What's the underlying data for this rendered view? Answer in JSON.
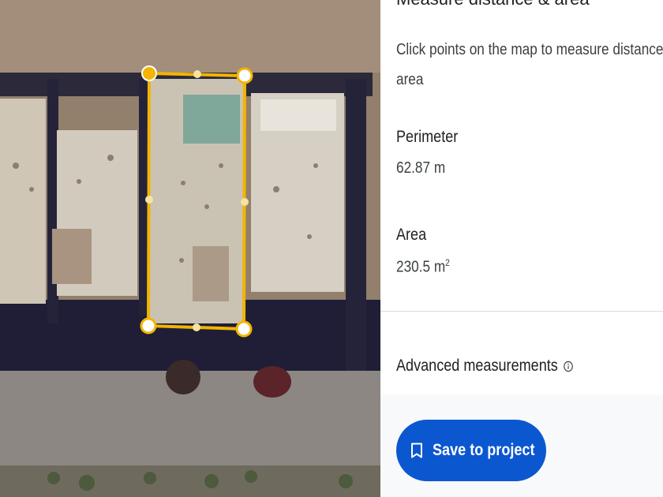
{
  "panel": {
    "title": "Measure distance & area",
    "instructions_line1": "Click points on the map to measure distance and",
    "instructions_line2": "area",
    "perimeter_label": "Perimeter",
    "perimeter_value": "62.87 m",
    "area_label": "Area",
    "area_value": "230.5 m",
    "area_unit_superscript": "2",
    "advanced_label": "Advanced measurements",
    "save_button_label": "Save to project"
  },
  "colors": {
    "polygon_stroke": "#f4b400",
    "button_bg": "#0b57d0",
    "footer_bg": "#f8f9fa"
  },
  "icons": {
    "info": "info-icon",
    "bookmark": "bookmark-icon",
    "vertex": "vertex-handle",
    "midpoint": "midpoint-handle"
  }
}
